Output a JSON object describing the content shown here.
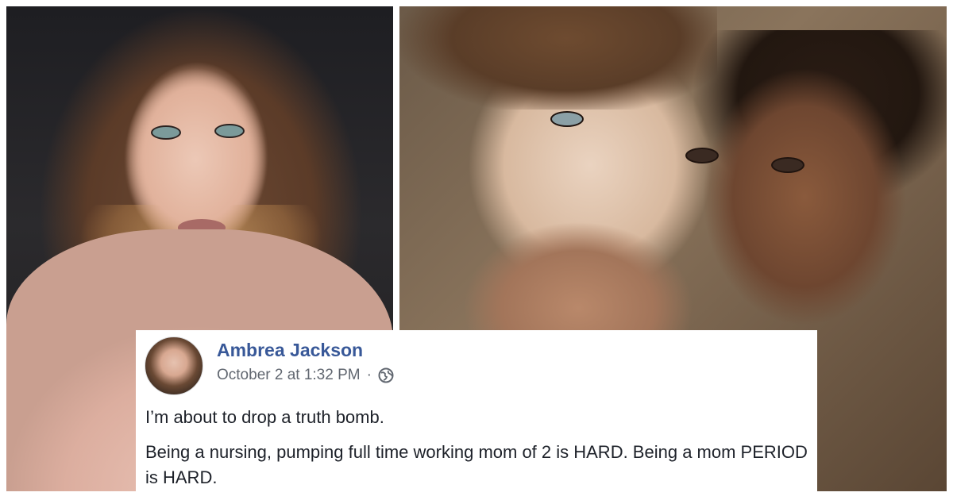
{
  "post": {
    "author_name": "Ambrea Jackson",
    "timestamp": "October 2 at 1:32 PM",
    "separator": "·",
    "privacy_icon": "globe-icon",
    "paragraphs": [
      "I’m about to drop a truth bomb.",
      "Being a nursing, pumping full time working mom of 2 is HARD. Being a mom PERIOD is HARD."
    ]
  },
  "colors": {
    "author_link": "#385898",
    "meta_text": "#616770",
    "body_text": "#1d2129"
  }
}
